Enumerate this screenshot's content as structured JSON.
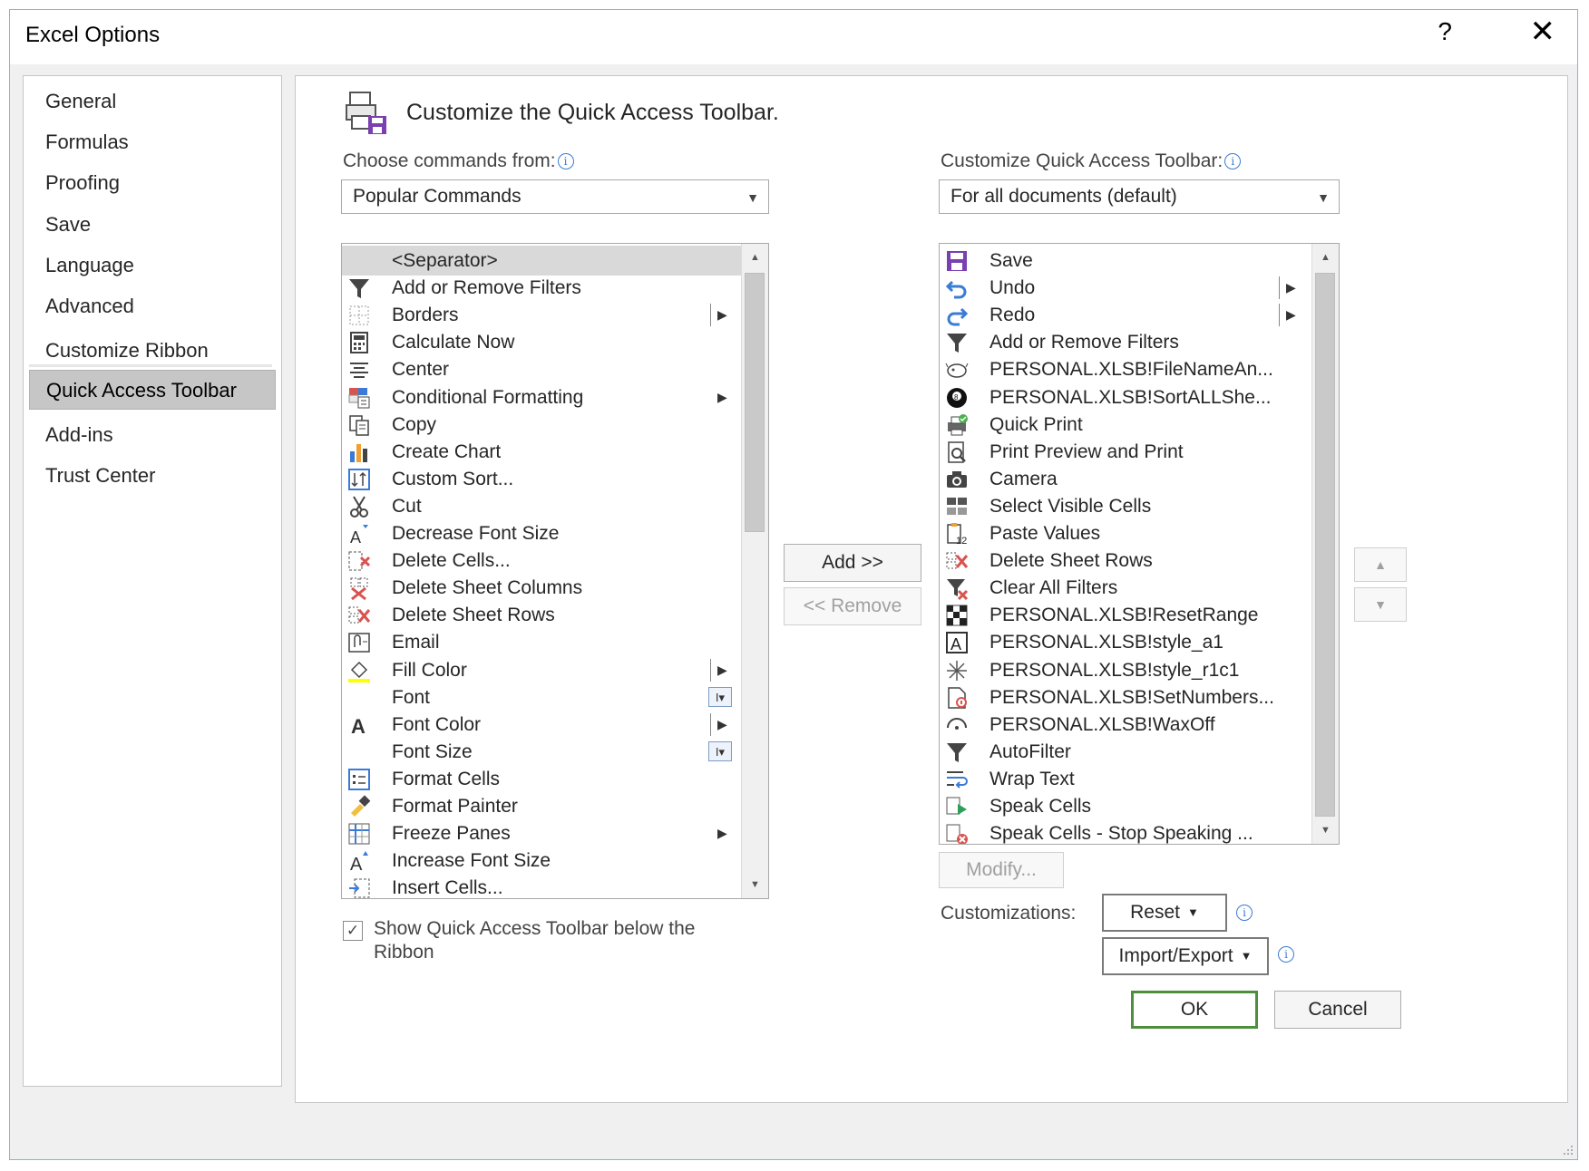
{
  "window": {
    "title": "Excel Options",
    "help_label": "?",
    "close_label": "✕"
  },
  "nav": {
    "items": [
      {
        "label": "General",
        "active": false
      },
      {
        "label": "Formulas",
        "active": false
      },
      {
        "label": "Proofing",
        "active": false
      },
      {
        "label": "Save",
        "active": false
      },
      {
        "label": "Language",
        "active": false
      },
      {
        "label": "Advanced",
        "active": false
      },
      {
        "label": "Customize Ribbon",
        "active": false
      },
      {
        "label": "Quick Access Toolbar",
        "active": true
      },
      {
        "label": "Add-ins",
        "active": false
      },
      {
        "label": "Trust Center",
        "active": false
      }
    ]
  },
  "main": {
    "heading": "Customize the Quick Access Toolbar.",
    "choose_label": "Choose commands from:",
    "choose_value": "Popular Commands",
    "customize_label": "Customize Quick Access Toolbar:",
    "customize_value": "For all documents (default)",
    "add_label": "Add >>",
    "remove_label": "<< Remove",
    "modify_label": "Modify...",
    "customizations_label": "Customizations:",
    "reset_label": "Reset",
    "import_export_label": "Import/Export",
    "show_below_label": "Show Quick Access Toolbar below the Ribbon",
    "show_below_checked": true
  },
  "commands": [
    {
      "label": "<Separator>",
      "icon": "separator",
      "selected": true
    },
    {
      "label": "Add or Remove Filters",
      "icon": "filter-icon"
    },
    {
      "label": "Borders",
      "icon": "borders-icon",
      "marker": "split"
    },
    {
      "label": "Calculate Now",
      "icon": "calculator-icon"
    },
    {
      "label": "Center",
      "icon": "align-center-icon"
    },
    {
      "label": "Conditional Formatting",
      "icon": "conditional-formatting-icon",
      "marker": "arrow"
    },
    {
      "label": "Copy",
      "icon": "copy-icon"
    },
    {
      "label": "Create Chart",
      "icon": "chart-icon"
    },
    {
      "label": "Custom Sort...",
      "icon": "sort-icon"
    },
    {
      "label": "Cut",
      "icon": "scissors-icon"
    },
    {
      "label": "Decrease Font Size",
      "icon": "decrease-font-icon"
    },
    {
      "label": "Delete Cells...",
      "icon": "delete-cells-icon"
    },
    {
      "label": "Delete Sheet Columns",
      "icon": "delete-columns-icon"
    },
    {
      "label": "Delete Sheet Rows",
      "icon": "delete-rows-icon"
    },
    {
      "label": "Email",
      "icon": "email-icon"
    },
    {
      "label": "Fill Color",
      "icon": "fill-color-icon",
      "marker": "split"
    },
    {
      "label": "Font",
      "icon": "none",
      "marker": "combo"
    },
    {
      "label": "Font Color",
      "icon": "font-color-icon",
      "marker": "split"
    },
    {
      "label": "Font Size",
      "icon": "none",
      "marker": "combo"
    },
    {
      "label": "Format Cells",
      "icon": "format-cells-icon"
    },
    {
      "label": "Format Painter",
      "icon": "format-painter-icon"
    },
    {
      "label": "Freeze Panes",
      "icon": "freeze-panes-icon",
      "marker": "arrow"
    },
    {
      "label": "Increase Font Size",
      "icon": "increase-font-icon"
    },
    {
      "label": "Insert Cells...",
      "icon": "insert-cells-icon"
    }
  ],
  "toolbar_items": [
    {
      "label": "Save",
      "icon": "save-icon"
    },
    {
      "label": "Undo",
      "icon": "undo-icon",
      "marker": "split"
    },
    {
      "label": "Redo",
      "icon": "redo-icon",
      "marker": "split"
    },
    {
      "label": "Add or Remove Filters",
      "icon": "filter-icon"
    },
    {
      "label": "PERSONAL.XLSB!FileNameAn...",
      "icon": "macro-icon"
    },
    {
      "label": "PERSONAL.XLSB!SortALLShe...",
      "icon": "eight-ball-icon"
    },
    {
      "label": "Quick Print",
      "icon": "quick-print-icon"
    },
    {
      "label": "Print Preview and Print",
      "icon": "print-preview-icon"
    },
    {
      "label": "Camera",
      "icon": "camera-icon"
    },
    {
      "label": "Select Visible Cells",
      "icon": "visible-cells-icon"
    },
    {
      "label": "Paste Values",
      "icon": "paste-values-icon"
    },
    {
      "label": "Delete Sheet Rows",
      "icon": "delete-rows-icon"
    },
    {
      "label": "Clear All Filters",
      "icon": "clear-filter-icon"
    },
    {
      "label": "PERSONAL.XLSB!ResetRange",
      "icon": "checker-icon"
    },
    {
      "label": "PERSONAL.XLSB!style_a1",
      "icon": "letter-a-icon"
    },
    {
      "label": "PERSONAL.XLSB!style_r1c1",
      "icon": "snowflake-icon"
    },
    {
      "label": "PERSONAL.XLSB!SetNumbers...",
      "icon": "document-icon"
    },
    {
      "label": "PERSONAL.XLSB!WaxOff",
      "icon": "wax-icon"
    },
    {
      "label": "AutoFilter",
      "icon": "filter-icon"
    },
    {
      "label": "Wrap Text",
      "icon": "wrap-text-icon"
    },
    {
      "label": "Speak Cells",
      "icon": "speak-cells-icon"
    },
    {
      "label": "Speak Cells - Stop Speaking ...",
      "icon": "speak-stop-icon"
    }
  ],
  "footer": {
    "ok_label": "OK",
    "cancel_label": "Cancel"
  },
  "colors": {
    "accent_blue": "#3a7bd5",
    "ok_border": "#4e8f3e",
    "selected_row": "#d9d9d9",
    "nav_active": "#c6c6c6"
  }
}
